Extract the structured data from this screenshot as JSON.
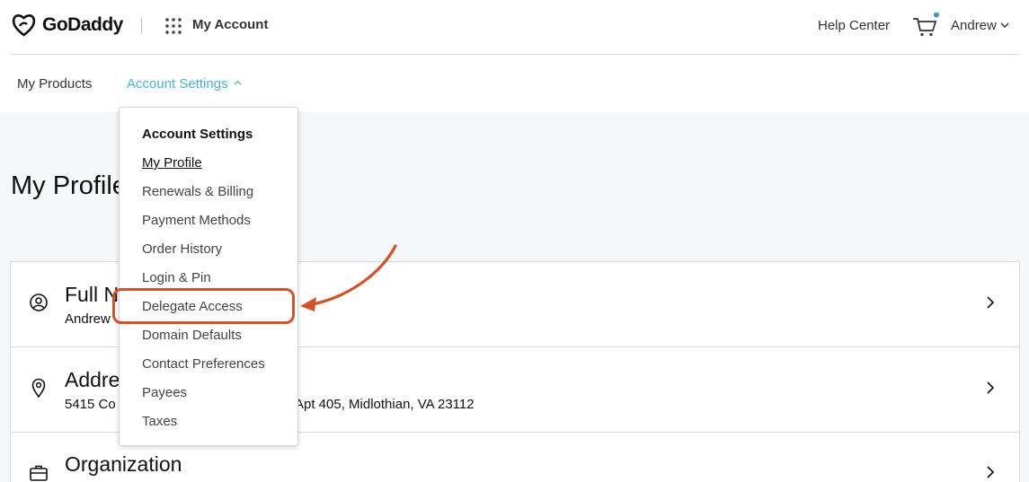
{
  "header": {
    "brand": "GoDaddy",
    "app_title": "My Account",
    "help": "Help Center",
    "user": "Andrew"
  },
  "subnav": {
    "products": "My Products",
    "settings": "Account Settings"
  },
  "page": {
    "title": "My Profile"
  },
  "cards": {
    "name": {
      "title": "Full N",
      "value": "Andrew"
    },
    "address": {
      "title": "Addre",
      "value_left": "5415 Co",
      "value_right": "Apt 405, Midlothian, VA 23112"
    },
    "organization": {
      "title": "Organization"
    }
  },
  "dropdown": {
    "heading": "Account Settings",
    "items": [
      "My Profile",
      "Renewals & Billing",
      "Payment Methods",
      "Order History",
      "Login & Pin",
      "Delegate Access",
      "Domain Defaults",
      "Contact Preferences",
      "Payees",
      "Taxes"
    ]
  },
  "colors": {
    "accent": "#4cb3c9",
    "annotation": "#d0542b",
    "cart_badge": "#3a9db5"
  }
}
